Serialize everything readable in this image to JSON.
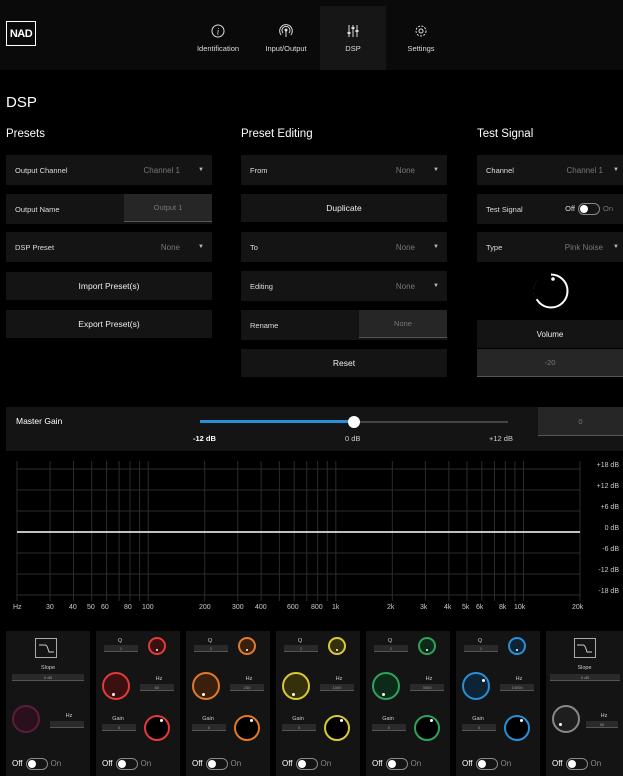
{
  "brand": {
    "logo": "NAD"
  },
  "nav": [
    {
      "label": "Identification",
      "icon": "info-icon"
    },
    {
      "label": "Input/Output",
      "icon": "signal-icon"
    },
    {
      "label": "DSP",
      "icon": "sliders-icon",
      "active": true
    },
    {
      "label": "Settings",
      "icon": "gear-icon"
    }
  ],
  "page_title": "DSP",
  "presets": {
    "title": "Presets",
    "output_channel": {
      "label": "Output Channel",
      "value": "Channel 1"
    },
    "output_name": {
      "label": "Output Name",
      "value": "Output 1"
    },
    "dsp_preset": {
      "label": "DSP Preset",
      "value": "None"
    },
    "import_label": "Import Preset(s)",
    "export_label": "Export Preset(s)"
  },
  "preset_editing": {
    "title": "Preset Editing",
    "from": {
      "label": "From",
      "value": "None"
    },
    "duplicate_label": "Duplicate",
    "to": {
      "label": "To",
      "value": "None"
    },
    "editing": {
      "label": "Editing",
      "value": "None"
    },
    "rename": {
      "label": "Rename",
      "value": "None"
    },
    "reset_label": "Reset"
  },
  "test_signal": {
    "title": "Test Signal",
    "channel": {
      "label": "Channel",
      "value": "Channel 1"
    },
    "test_signal": {
      "label": "Test Signal",
      "off": "Off",
      "on": "On"
    },
    "type": {
      "label": "Type",
      "value": "Pink Noise"
    },
    "volume_label": "Volume",
    "volume_value": "-20"
  },
  "master_gain": {
    "label": "Master Gain",
    "min": "-12 dB",
    "mid": "0 dB",
    "max": "+12 dB",
    "value": "0",
    "level_db": 0
  },
  "graph": {
    "y_labels": [
      "+18 dB",
      "+12 dB",
      "+6 dB",
      "0 dB",
      "-6 dB",
      "-12 dB",
      "-18 dB"
    ],
    "x_labels": [
      "Hz",
      "30",
      "40",
      "50",
      "60",
      "80",
      "100",
      "200",
      "300",
      "400",
      "600",
      "800",
      "1k",
      "2k",
      "3k",
      "4k",
      "5k",
      "6k",
      "8k",
      "10k",
      "20k"
    ]
  },
  "bands": {
    "slope_label": "Slope",
    "slope_value": "0 dB",
    "q_label": "Q",
    "q_value": "1",
    "hz_label": "Hz",
    "gain_label": "Gain",
    "gain_value": "0",
    "off": "Off",
    "on": "On",
    "filters": [
      {
        "type": "low-shelf",
        "hz": "",
        "color": "#5a1e3c"
      },
      {
        "type": "peq",
        "hz": "60",
        "color": "#e23b3b"
      },
      {
        "type": "peq",
        "hz": "230",
        "color": "#e07a2a"
      },
      {
        "type": "peq",
        "hz": "1000",
        "color": "#d9c93a"
      },
      {
        "type": "peq",
        "hz": "3000",
        "color": "#2fa35a"
      },
      {
        "type": "peq",
        "hz": "14000",
        "color": "#2a8fd6"
      },
      {
        "type": "high-shelf",
        "hz": "50",
        "color": "#888888"
      }
    ]
  }
}
